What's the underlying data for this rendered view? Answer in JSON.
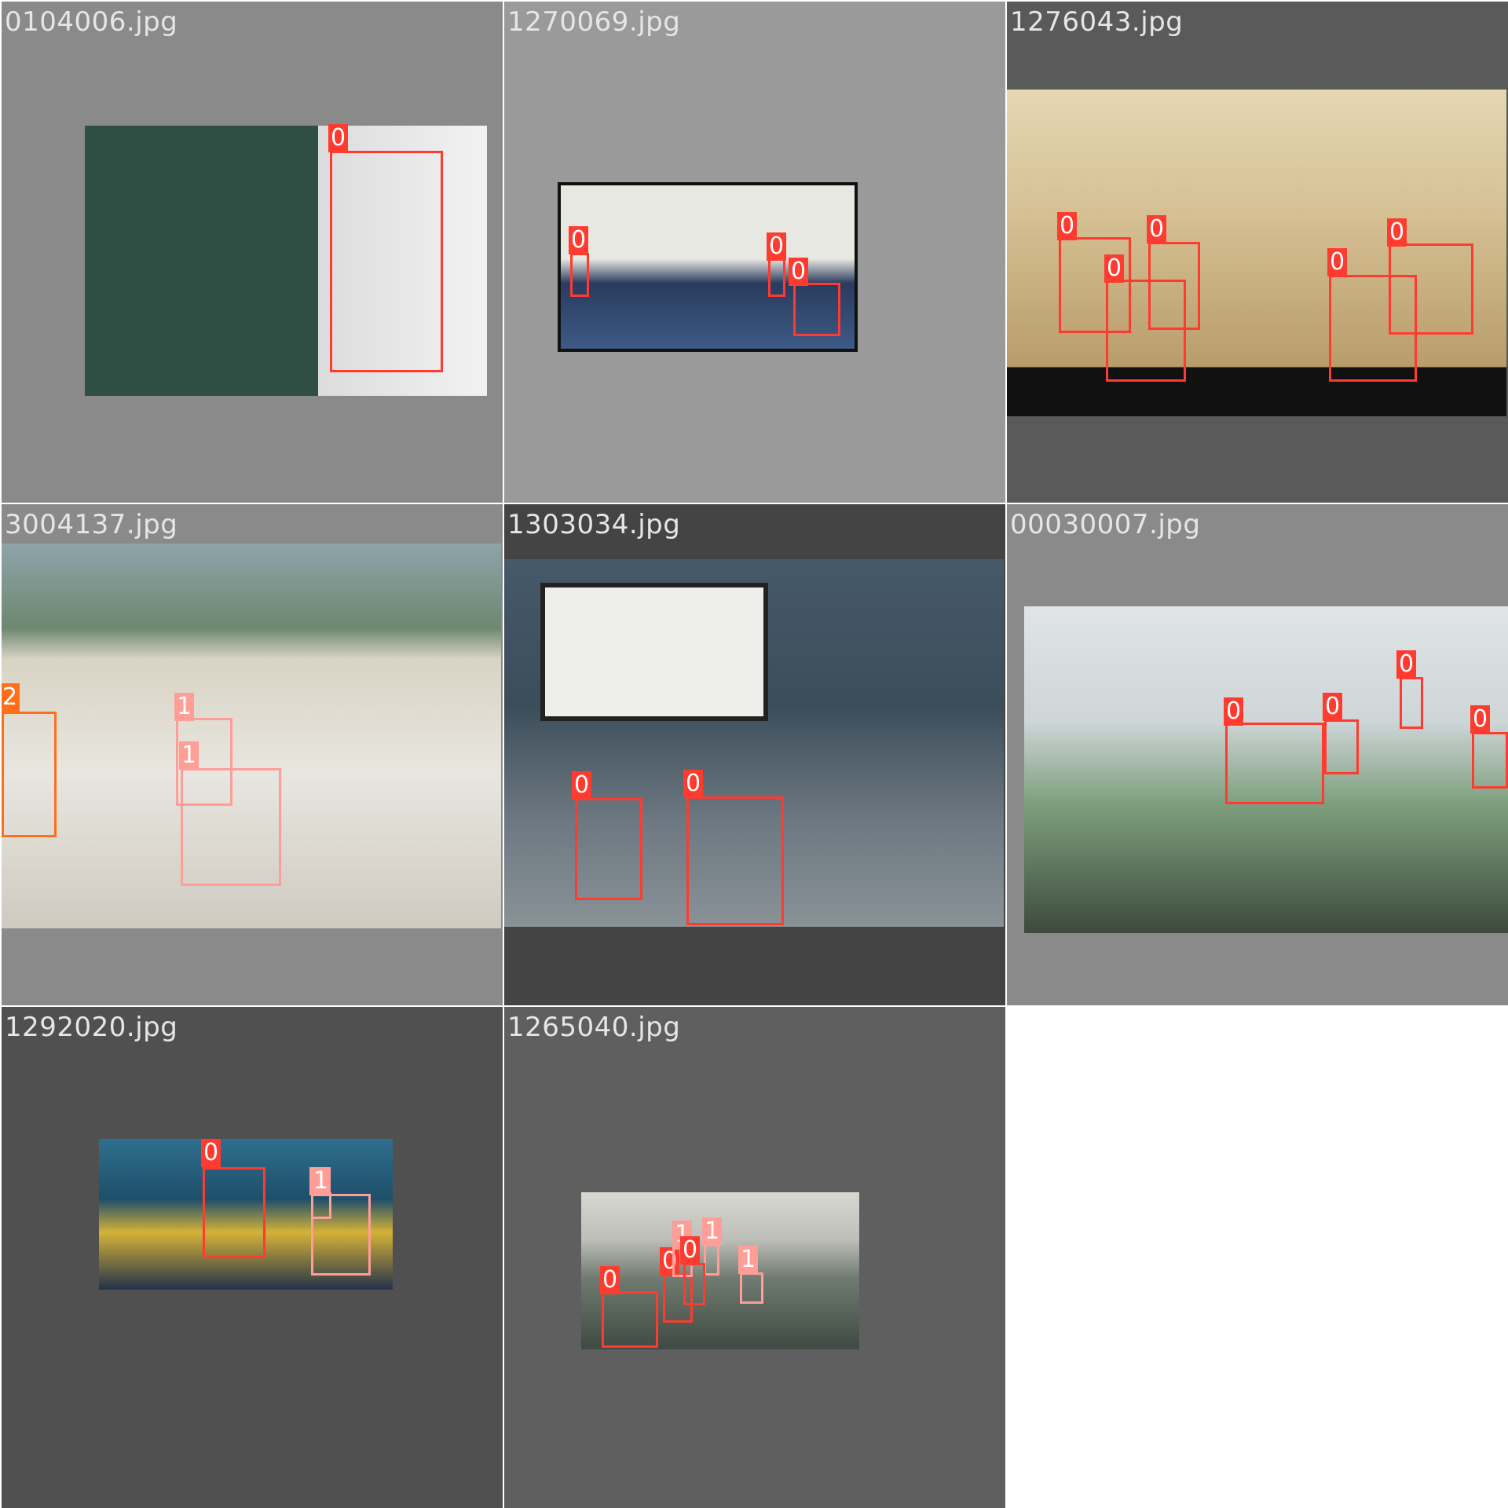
{
  "colors": {
    "class_0": "#ff3b30",
    "class_1": "#ff9d97",
    "class_2": "#ff6f1a",
    "background": "#ffffff"
  },
  "tiles": [
    {
      "name": "0104006.jpg",
      "bg": "#8a8a8a",
      "photo_tone": [
        "#2f4f44",
        "#d8d8d8"
      ],
      "boxes": [
        {
          "label": "0"
        }
      ]
    },
    {
      "name": "1270069.jpg",
      "bg": "#9a9a9a",
      "photo_tone": [
        "#e6e6e0",
        "#223355"
      ],
      "boxes": [
        {
          "label": "0"
        },
        {
          "label": "0"
        },
        {
          "label": "0"
        }
      ]
    },
    {
      "name": "1276043.jpg",
      "bg": "#5a5a5a",
      "photo_tone": [
        "#d9c9a6",
        "#b79b6c"
      ],
      "boxes": [
        {
          "label": "0"
        },
        {
          "label": "0"
        },
        {
          "label": "0"
        },
        {
          "label": "0"
        },
        {
          "label": "0"
        }
      ]
    },
    {
      "name": "3004137.jpg",
      "bg": "#8a8a8a",
      "photo_tone": [
        "#8aa0a8",
        "#e8e6e0"
      ],
      "boxes": [
        {
          "label": "2"
        },
        {
          "label": "1"
        },
        {
          "label": "1"
        }
      ]
    },
    {
      "name": "1303034.jpg",
      "bg": "#444444",
      "photo_tone": [
        "#3a4d5a",
        "#6d7a80"
      ],
      "boxes": [
        {
          "label": "0"
        },
        {
          "label": "0"
        }
      ]
    },
    {
      "name": "00030007.jpg",
      "bg": "#8a8a8a",
      "photo_tone": [
        "#d8dde0",
        "#6b8a6b"
      ],
      "boxes": [
        {
          "label": "0"
        },
        {
          "label": "0"
        },
        {
          "label": "0"
        },
        {
          "label": "0"
        }
      ]
    },
    {
      "name": "1292020.jpg",
      "bg": "#505050",
      "photo_tone": [
        "#1f4f6e",
        "#c9a430"
      ],
      "boxes": [
        {
          "label": "0"
        },
        {
          "label": "1"
        },
        {
          "label": "1"
        }
      ]
    },
    {
      "name": "1265040.jpg",
      "bg": "#5f5f5f",
      "photo_tone": [
        "#c9ccc4",
        "#4f5a52"
      ],
      "boxes": [
        {
          "label": "0"
        },
        {
          "label": "0"
        },
        {
          "label": "1"
        },
        {
          "label": "1"
        },
        {
          "label": "1"
        },
        {
          "label": "0"
        }
      ]
    }
  ]
}
